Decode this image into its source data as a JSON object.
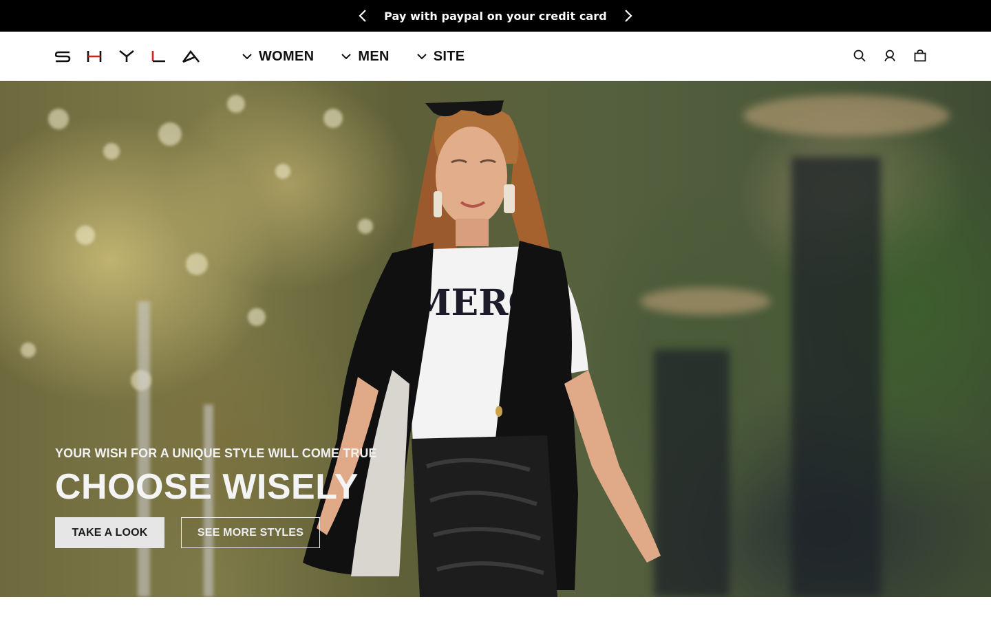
{
  "announcement": {
    "text": "Pay with paypal on your credit card",
    "prev_icon": "chevron-left-icon",
    "next_icon": "chevron-right-icon"
  },
  "header": {
    "logo": "SHYLA",
    "nav": [
      {
        "label": "WOMEN",
        "icon": "chevron-down-icon"
      },
      {
        "label": "MEN",
        "icon": "chevron-down-icon"
      },
      {
        "label": "SITE",
        "icon": "chevron-down-icon"
      }
    ],
    "tools": [
      "search-icon",
      "account-icon",
      "shopping-bag-icon"
    ]
  },
  "hero": {
    "subtitle": "YOUR WISH FOR A UNIQUE STYLE WILL COME TRUE",
    "title": "CHOOSE WISELY",
    "primary_button": "TAKE A LOOK",
    "secondary_button": "SEE MORE STYLES",
    "shirt_print": "MERC"
  },
  "colors": {
    "announcement_bg": "#000000",
    "logo_accent": "#e01b1b",
    "text_dark": "#111111"
  }
}
